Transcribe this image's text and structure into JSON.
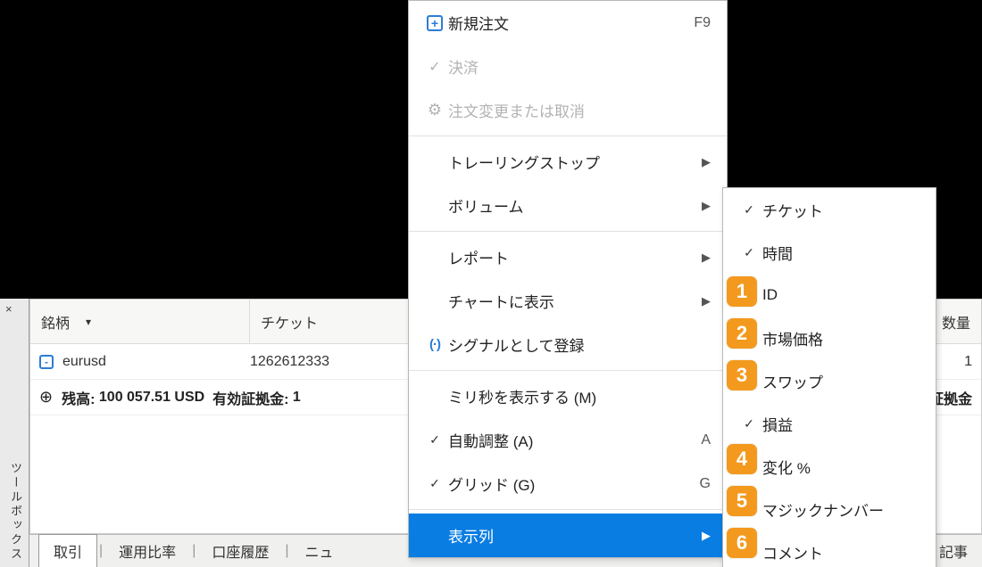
{
  "panel": {
    "close_x": "×",
    "vertical_label": "ツールボックス",
    "headers": {
      "symbol": "銘柄",
      "sort_glyph": "▾",
      "ticket": "チケット",
      "qty": "数量"
    },
    "row": {
      "symbol": "eurusd",
      "ticket": "1262612333",
      "qty": "1"
    },
    "summary": {
      "plus": "⊕",
      "balance_label": "残高:",
      "balance": "100 057.51 USD",
      "margin_label": "有効証拠金:",
      "margin_trunc": "1",
      "right_trunc": "証拠金"
    }
  },
  "tabs": {
    "t1": "取引",
    "t2": "運用比率",
    "t3": "口座履歴",
    "t4": "ニュ",
    "right": "記事"
  },
  "menu": {
    "new_order": "新規注文",
    "new_order_accel": "F9",
    "close_pos": "決済",
    "modify": "注文変更または取消",
    "trailing": "トレーリングストップ",
    "volume": "ボリューム",
    "report": "レポート",
    "show_on_chart": "チャートに表示",
    "signal": "シグナルとして登録",
    "show_ms": "ミリ秒を表示する (M)",
    "auto_arrange": "自動調整 (A)",
    "auto_arrange_accel": "A",
    "grid": "グリッド (G)",
    "grid_accel": "G",
    "columns": "表示列"
  },
  "submenu": {
    "ticket": "チケット",
    "time": "時間",
    "id": "ID",
    "market_price": "市場価格",
    "swap": "スワップ",
    "profit": "損益",
    "change_pct": "変化 %",
    "magic": "マジックナンバー",
    "comment": "コメント"
  },
  "badges": {
    "b1": "1",
    "b2": "2",
    "b3": "3",
    "b4": "4",
    "b5": "5",
    "b6": "6"
  }
}
